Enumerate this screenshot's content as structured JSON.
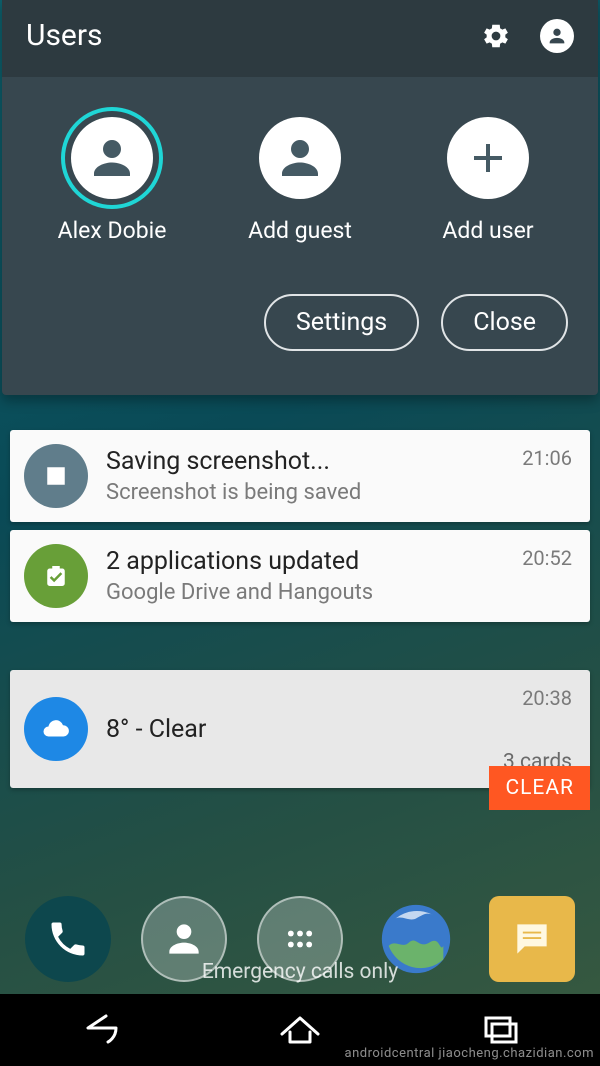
{
  "panel": {
    "title": "Users",
    "users": [
      {
        "label": "Alex Dobie"
      },
      {
        "label": "Add guest"
      },
      {
        "label": "Add user"
      }
    ],
    "buttons": {
      "settings": "Settings",
      "close": "Close"
    }
  },
  "notifications": [
    {
      "icon_bg": "#607d8b",
      "title": "Saving screenshot...",
      "subtitle": "Screenshot is being saved",
      "time": "21:06"
    },
    {
      "icon_bg": "#689f38",
      "title": "2 applications updated",
      "subtitle": "Google Drive and Hangouts",
      "time": "20:52"
    },
    {
      "icon_bg": "#1e88e5",
      "title": "8° - Clear",
      "subtitle": "",
      "time": "20:38",
      "extra": "3 cards"
    }
  ],
  "clear_label": "CLEAR",
  "emergency": "Emergency calls only",
  "watermark": "androidcentral\njiaocheng.chazidian.com"
}
